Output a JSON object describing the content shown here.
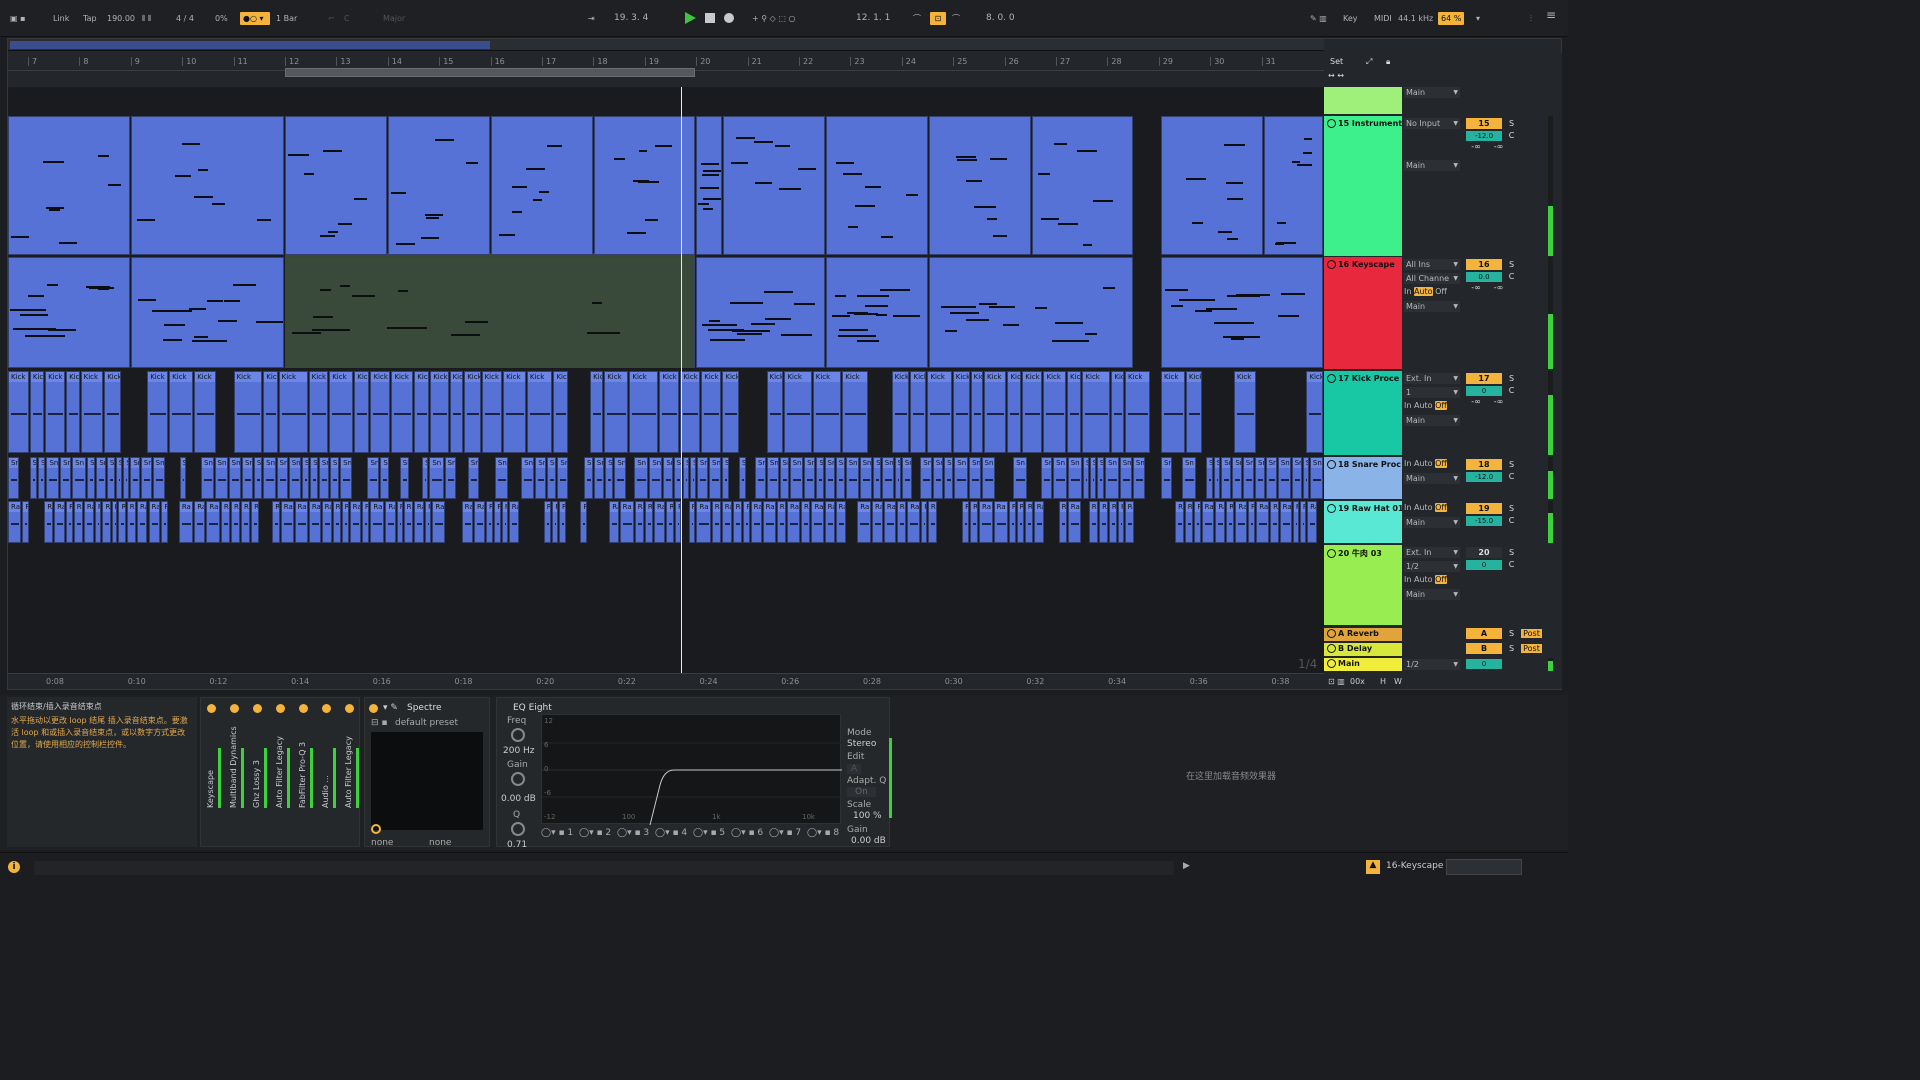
{
  "transport": {
    "link": "Link",
    "tap": "Tap",
    "tempo": "190.00",
    "signature": "4 / 4",
    "swing": "0%",
    "quantize": "1 Bar",
    "position": "19.  3.  4",
    "loop_start": "12.  1.  1",
    "loop_length": "8.  0.  0",
    "key_label": "Key",
    "midi_label": "MIDI",
    "sample_rate": "44.1 kHz",
    "cpu": "64 %",
    "scale_root": "C",
    "scale_mode": "Major"
  },
  "ruler": {
    "bars": [
      "7",
      "8",
      "9",
      "10",
      "11",
      "12",
      "13",
      "14",
      "15",
      "16",
      "17",
      "18",
      "19",
      "20",
      "21",
      "22",
      "23",
      "24",
      "25",
      "26",
      "27",
      "28",
      "29",
      "30",
      "31"
    ],
    "times": [
      "0:08",
      "0:10",
      "0:12",
      "0:14",
      "0:16",
      "0:18",
      "0:20",
      "0:22",
      "0:24",
      "0:26",
      "0:28",
      "0:30",
      "0:32",
      "0:34",
      "0:36",
      "0:38"
    ],
    "zoom": "1/4"
  },
  "tracks": {
    "set_label": "Set",
    "main_top": "Main",
    "t15": {
      "name": "15 Instrument",
      "color": "#3ef08c",
      "in": "No Input",
      "out": "Main",
      "num": "15",
      "vol": "-12.0"
    },
    "t16": {
      "name": "16 Keyscape",
      "color": "#e8283c",
      "in": "All Ins",
      "ch": "All Channe",
      "out": "Main",
      "num": "16",
      "vol": "0.0",
      "monitor_in": "In",
      "monitor_auto": "Auto",
      "monitor_off": "Off"
    },
    "t17": {
      "name": "17 Kick Proce",
      "color": "#18c8a4",
      "in": "Ext. In",
      "ch": "1",
      "out": "Main",
      "num": "17",
      "vol": "0"
    },
    "t18": {
      "name": "18 Snare Proc",
      "color": "#8ab4e8",
      "out": "Main",
      "num": "18",
      "vol": "-12.0"
    },
    "t19": {
      "name": "19 Raw Hat 01",
      "color": "#58e8d4",
      "out": "Main",
      "num": "19",
      "vol": "-15.0"
    },
    "t20": {
      "name": "20 牛肉 03",
      "color": "#98ee50",
      "in": "Ext. In",
      "ch": "1/2",
      "out": "Main",
      "num": "20",
      "vol": "0"
    },
    "reverb": {
      "name": "A Reverb",
      "color": "#e0a43a",
      "num": "A",
      "post": "Post"
    },
    "delay": {
      "name": "B Delay",
      "color": "#d8e83a",
      "num": "B",
      "post": "Post"
    },
    "master": {
      "name": "Main",
      "color": "#f0ee3a",
      "out": "1/2",
      "num": "0"
    },
    "solo": "S",
    "center": "C",
    "inf": "-∞",
    "clip_kick": "Kick",
    "clip_snare": "Sn",
    "clip_hat": "Ra",
    "zoom_level": "00x",
    "h": "H",
    "w": "W"
  },
  "info": {
    "title": "循环结束/插入录音结束点",
    "body": "水平拖动以更改 loop 结尾 插入录音结束点。要激活 loop 和或插入录音结束点，或以数字方式更改位置，请使用相应的控制栏控件。"
  },
  "devices": {
    "rack_items": [
      "Keyscape",
      "Multiband Dynamics",
      "Ghz Lossy 3",
      "Auto Filter Legacy",
      "FabFilter Pro-Q 3",
      "Audio ...",
      "Auto Filter Legacy"
    ],
    "spectre_name": "Spectre",
    "spectre_preset": "default preset",
    "none1": "none",
    "none2": "none",
    "eq_name": "EQ Eight",
    "freq_label": "Freq",
    "freq_val": "200 Hz",
    "gain_label": "Gain",
    "gain_val": "0.00 dB",
    "q_label": "Q",
    "q_val": "0.71",
    "db_ticks": [
      "12",
      "6",
      "0",
      "-6",
      "-12"
    ],
    "freq_ticks": [
      "100",
      "1k",
      "10k"
    ],
    "bands": [
      "1",
      "2",
      "3",
      "4",
      "5",
      "6",
      "7",
      "8"
    ],
    "mode_label": "Mode",
    "mode_val": "Stereo",
    "edit_label": "Edit",
    "edit_val": "A",
    "adapt_label": "Adapt. Q",
    "adapt_val": "On",
    "scale_label": "Scale",
    "scale_val": "100 %",
    "out_gain_label": "Gain",
    "out_gain_val": "0.00 dB",
    "drop_hint": "在这里加载音频效果器"
  },
  "status": {
    "track": "16-Keyscape"
  }
}
